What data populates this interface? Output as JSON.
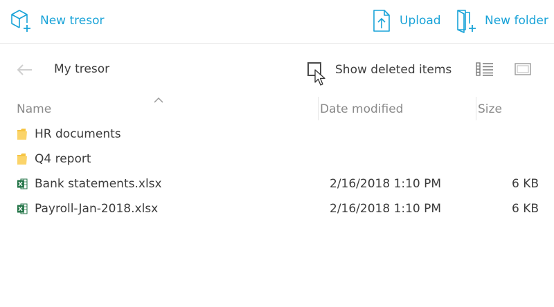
{
  "toolbar": {
    "new_tresor": {
      "label": "New tresor",
      "icon": "new-tresor-icon"
    },
    "upload": {
      "label": "Upload",
      "icon": "upload-icon"
    },
    "new_folder": {
      "label": "New folder",
      "icon": "new-folder-icon"
    }
  },
  "nav": {
    "back_icon": "back-arrow-icon",
    "breadcrumb": "My tresor",
    "show_deleted": {
      "label": "Show deleted items",
      "checked": false
    },
    "view_modes": [
      "list-view-icon",
      "tile-view-icon"
    ]
  },
  "table": {
    "columns": {
      "name": "Name",
      "date": "Date modified",
      "size": "Size"
    },
    "sort": {
      "column": "name",
      "direction": "ascending"
    },
    "rows": [
      {
        "type": "folder",
        "icon": "folder-icon",
        "name": "HR documents",
        "date": "",
        "size": ""
      },
      {
        "type": "folder",
        "icon": "folder-icon",
        "name": "Q4 report",
        "date": "",
        "size": ""
      },
      {
        "type": "file",
        "icon": "excel-file-icon",
        "name": "Bank statements.xlsx",
        "date": "2/16/2018 1:10 PM",
        "size": "6 KB"
      },
      {
        "type": "file",
        "icon": "excel-file-icon",
        "name": "Payroll-Jan-2018.xlsx",
        "date": "2/16/2018 1:10 PM",
        "size": "6 KB"
      }
    ]
  },
  "colors": {
    "accent": "#19a3d8",
    "text": "#3c3c3c",
    "muted": "#8a8a8a",
    "folder": "#f6c443",
    "excel": "#1f7244"
  }
}
